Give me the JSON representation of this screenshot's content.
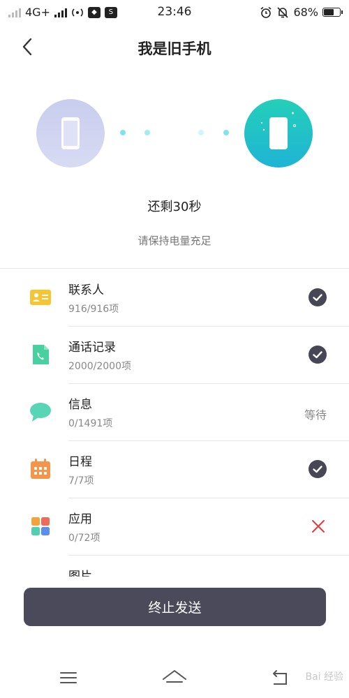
{
  "status_bar": {
    "network": "4G+",
    "time": "23:46",
    "battery_text": "68%",
    "battery_level": 0.68
  },
  "header": {
    "title": "我是旧手机"
  },
  "transfer": {
    "remaining": "还剩30秒",
    "hint": "请保持电量充足",
    "colors": {
      "old_phone": "#c9cdee",
      "new_phone": "#1fc4c4",
      "dot": "#7fe3ea"
    }
  },
  "items": [
    {
      "name": "联系人",
      "count": "916/916项",
      "status": "done",
      "icon": "contact-card-icon",
      "color": "#f7c531"
    },
    {
      "name": "通话记录",
      "count": "2000/2000项",
      "status": "done",
      "icon": "call-log-icon",
      "color": "#49d0a0"
    },
    {
      "name": "信息",
      "count": "0/1491项",
      "status": "waiting",
      "status_text": "等待",
      "icon": "message-bubble-icon",
      "color": "#58d5b4"
    },
    {
      "name": "日程",
      "count": "7/7项",
      "status": "done",
      "icon": "calendar-icon",
      "color": "#f5954a"
    },
    {
      "name": "应用",
      "count": "0/72项",
      "status": "failed",
      "icon": "apps-grid-icon",
      "color": "#e23b3b"
    },
    {
      "name": "图片",
      "count": "",
      "status": "",
      "icon": "picture-icon",
      "color": "#c47be0"
    }
  ],
  "stop_button": {
    "label": "终止发送"
  },
  "nav_bar": {
    "icons": [
      "menu-icon",
      "home-icon",
      "back-icon"
    ],
    "watermark": "Bai 经验"
  }
}
